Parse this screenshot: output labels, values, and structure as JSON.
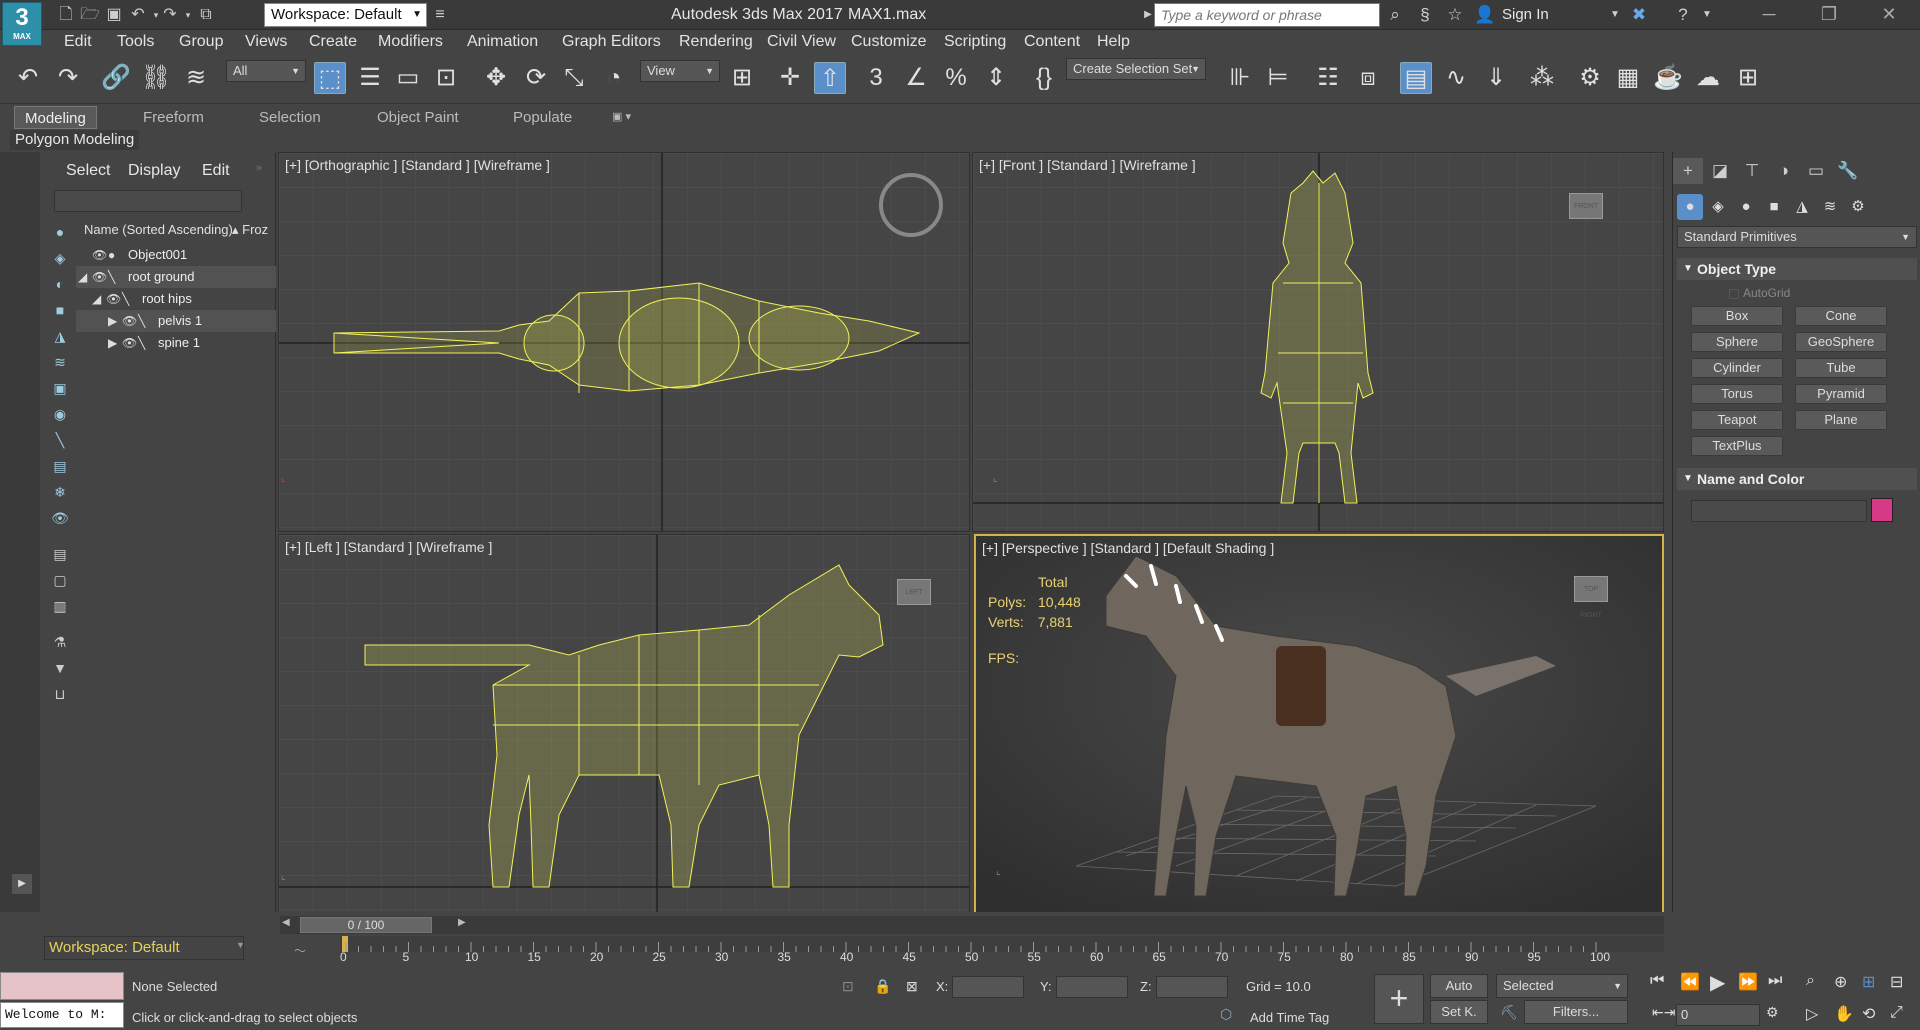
{
  "app": {
    "title": "Autodesk 3ds Max 2017",
    "file": "MAX1.max",
    "logo_number": "3",
    "logo_sub": "MAX",
    "workspace": "Workspace: Default",
    "search_placeholder": "Type a keyword or phrase",
    "sign_in": "Sign In"
  },
  "menu": [
    "Edit",
    "Tools",
    "Group",
    "Views",
    "Create",
    "Modifiers",
    "Animation",
    "Graph Editors",
    "Rendering",
    "Civil View",
    "Customize",
    "Scripting",
    "Content",
    "Help"
  ],
  "toolbar": {
    "filter": "All",
    "ref_coord": "View",
    "selection_set": "Create Selection Set"
  },
  "ribbon": {
    "tabs": [
      "Modeling",
      "Freeform",
      "Selection",
      "Object Paint",
      "Populate"
    ],
    "active_tab": "Modeling",
    "sub_label": "Polygon Modeling"
  },
  "explorer": {
    "tabs": [
      "Select",
      "Display",
      "Edit"
    ],
    "column_name": "Name (Sorted Ascending)",
    "column_frozen": "▴ Froz",
    "rows": [
      "Object001",
      "root ground",
      "root hips",
      "pelvis 1",
      "spine 1"
    ],
    "workspace": "Workspace: Default"
  },
  "viewports": {
    "top_left": "[+] [Orthographic ] [Standard ] [Wireframe ]",
    "top_right": "[+] [Front ] [Standard ] [Wireframe ]",
    "bottom_left": "[+] [Left ] [Standard ] [Wireframe ]",
    "bottom_right": "[+] [Perspective ] [Standard ] [Default Shading ]",
    "stats": {
      "total_label": "Total",
      "polys_label": "Polys:",
      "polys": "10,448",
      "verts_label": "Verts:",
      "verts": "7,881",
      "fps_label": "FPS:"
    },
    "cube_front": "FRONT",
    "cube_left": "LEFT",
    "cube_persp": "TOP  RIGHT"
  },
  "command_panel": {
    "dropdown": "Standard Primitives",
    "object_type_title": "Object Type",
    "autogrid": "AutoGrid",
    "buttons": [
      "Box",
      "Cone",
      "Sphere",
      "GeoSphere",
      "Cylinder",
      "Tube",
      "Torus",
      "Pyramid",
      "Teapot",
      "Plane",
      "TextPlus"
    ],
    "name_color_title": "Name and Color",
    "color": "#d63a86"
  },
  "timeline": {
    "frame": "0 / 100",
    "ticks": [
      "0",
      "5",
      "10",
      "15",
      "20",
      "25",
      "30",
      "35",
      "40",
      "45",
      "50",
      "55",
      "60",
      "65",
      "70",
      "75",
      "80",
      "85",
      "90",
      "95",
      "100"
    ]
  },
  "status": {
    "maxscript": "Welcome to M:",
    "selection": "None Selected",
    "prompt": "Click or click-and-drag to select objects",
    "x_label": "X:",
    "y_label": "Y:",
    "z_label": "Z:",
    "grid": "Grid = 10.0",
    "add_time_tag": "Add Time Tag",
    "auto": "Auto",
    "set_key": "Set K.",
    "key_filter": "Selected",
    "filters": "Filters...",
    "frame_field": "0"
  }
}
